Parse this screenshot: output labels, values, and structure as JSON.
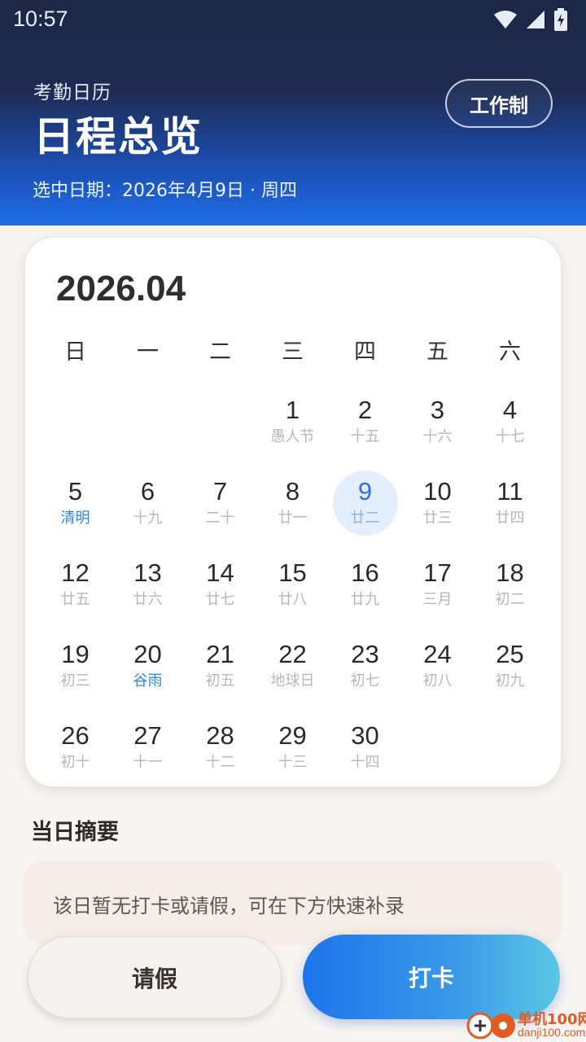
{
  "status_bar": {
    "time": "10:57",
    "icons": [
      "wifi-icon",
      "cell-signal-icon",
      "battery-charging-icon"
    ]
  },
  "header": {
    "subtitle": "考勤日历",
    "title": "日程总览",
    "selected_date_text": "选中日期：2026年4月9日 · 周四",
    "work_button_label": "工作制"
  },
  "calendar": {
    "month_label": "2026.04",
    "weekdays": [
      "日",
      "一",
      "二",
      "三",
      "四",
      "五",
      "六"
    ],
    "selected_day": 9,
    "days": [
      null,
      null,
      null,
      {
        "num": "1",
        "lunar": "愚人节",
        "term": false
      },
      {
        "num": "2",
        "lunar": "十五",
        "term": false
      },
      {
        "num": "3",
        "lunar": "十六",
        "term": false
      },
      {
        "num": "4",
        "lunar": "十七",
        "term": false
      },
      {
        "num": "5",
        "lunar": "清明",
        "term": true
      },
      {
        "num": "6",
        "lunar": "十九",
        "term": false
      },
      {
        "num": "7",
        "lunar": "二十",
        "term": false
      },
      {
        "num": "8",
        "lunar": "廿一",
        "term": false
      },
      {
        "num": "9",
        "lunar": "廿二",
        "term": false
      },
      {
        "num": "10",
        "lunar": "廿三",
        "term": false
      },
      {
        "num": "11",
        "lunar": "廿四",
        "term": false
      },
      {
        "num": "12",
        "lunar": "廿五",
        "term": false
      },
      {
        "num": "13",
        "lunar": "廿六",
        "term": false
      },
      {
        "num": "14",
        "lunar": "廿七",
        "term": false
      },
      {
        "num": "15",
        "lunar": "廿八",
        "term": false
      },
      {
        "num": "16",
        "lunar": "廿九",
        "term": false
      },
      {
        "num": "17",
        "lunar": "三月",
        "term": false
      },
      {
        "num": "18",
        "lunar": "初二",
        "term": false
      },
      {
        "num": "19",
        "lunar": "初三",
        "term": false
      },
      {
        "num": "20",
        "lunar": "谷雨",
        "term": true
      },
      {
        "num": "21",
        "lunar": "初五",
        "term": false
      },
      {
        "num": "22",
        "lunar": "地球日",
        "term": false
      },
      {
        "num": "23",
        "lunar": "初七",
        "term": false
      },
      {
        "num": "24",
        "lunar": "初八",
        "term": false
      },
      {
        "num": "25",
        "lunar": "初九",
        "term": false
      },
      {
        "num": "26",
        "lunar": "初十",
        "term": false
      },
      {
        "num": "27",
        "lunar": "十一",
        "term": false
      },
      {
        "num": "28",
        "lunar": "十二",
        "term": false
      },
      {
        "num": "29",
        "lunar": "十三",
        "term": false
      },
      {
        "num": "30",
        "lunar": "十四",
        "term": false
      }
    ]
  },
  "summary": {
    "title": "当日摘要",
    "text": "该日暂无打卡或请假，可在下方快速补录"
  },
  "actions": {
    "leave_label": "请假",
    "punch_label": "打卡"
  },
  "watermark": {
    "site": "单机100网",
    "url": "danji100.com"
  },
  "colors": {
    "accent": "#1f6ee8",
    "term": "#2f86e8",
    "selected_bg": "#e5eefc"
  }
}
